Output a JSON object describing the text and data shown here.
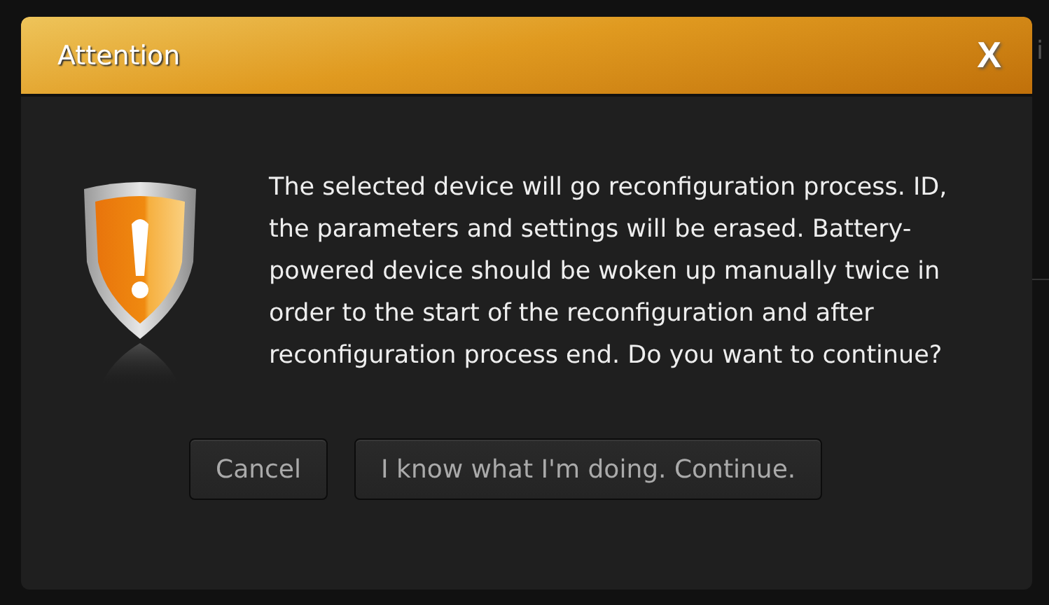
{
  "background": {
    "text": "i"
  },
  "dialog": {
    "title": "Attention",
    "close": "X",
    "message": "The selected device will go reconfiguration process. ID, the parameters and settings will be erased. Battery-powered device should be woken up manually twice in order to the start of the reconfiguration and after reconfiguration process end. Do you want to continue?",
    "buttons": [
      {
        "label": "Cancel"
      },
      {
        "label": "I know what I'm doing. Continue."
      }
    ]
  }
}
